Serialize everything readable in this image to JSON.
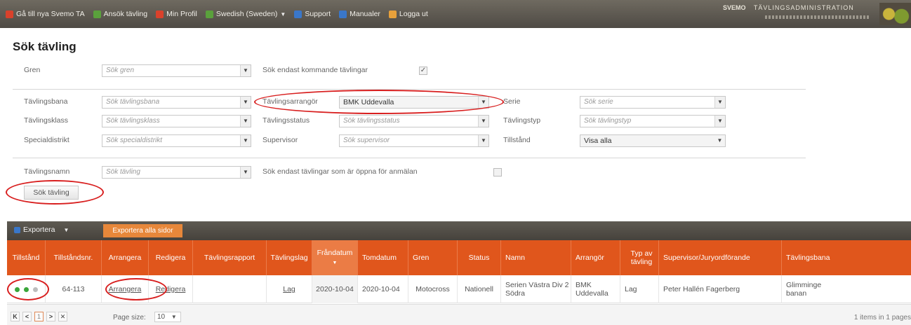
{
  "topnav": {
    "items": [
      {
        "label": "Gå till nya Svemo TA",
        "icon": "person-icon",
        "color": "#d9412b"
      },
      {
        "label": "Ansök tävling",
        "icon": "flag-icon",
        "color": "#5aa13c"
      },
      {
        "label": "Min Profil",
        "icon": "person-icon",
        "color": "#d9412b"
      },
      {
        "label": "Swedish (Sweden)",
        "icon": "arrow-left-icon",
        "color": "#5aa13c"
      },
      {
        "label": "Support",
        "icon": "info-icon",
        "color": "#3a77c9"
      },
      {
        "label": "Manualer",
        "icon": "book-icon",
        "color": "#3a77c9"
      },
      {
        "label": "Logga ut",
        "icon": "logout-icon",
        "color": "#e8a13b"
      }
    ],
    "brand_logo": "SVEMO",
    "brand_title": "TÄVLINGSADMINISTRATION"
  },
  "page_title": "Sök tävling",
  "filters": {
    "gren": {
      "label": "Gren",
      "placeholder": "Sök gren"
    },
    "upcoming_only": {
      "label": "Sök endast kommande tävlingar",
      "checked": true
    },
    "tavlingsbana": {
      "label": "Tävlingsbana",
      "placeholder": "Sök tävlingsbana"
    },
    "tavlingsarrangor": {
      "label": "Tävlingsarrangör",
      "value": "BMK Uddevalla"
    },
    "serie": {
      "label": "Serie",
      "placeholder": "Sök serie"
    },
    "tavlingsklass": {
      "label": "Tävlingsklass",
      "placeholder": "Sök tävlingsklass"
    },
    "tavlingsstatus": {
      "label": "Tävlingsstatus",
      "placeholder": "Sök tävlingsstatus"
    },
    "tavlingstyp": {
      "label": "Tävlingstyp",
      "placeholder": "Sök tävlingstyp"
    },
    "specialdistrikt": {
      "label": "Specialdistrikt",
      "placeholder": "Sök specialdistrikt"
    },
    "supervisor": {
      "label": "Supervisor",
      "placeholder": "Sök supervisor"
    },
    "tillstand": {
      "label": "Tillstånd",
      "value": "Visa alla"
    },
    "tavlingsnamn": {
      "label": "Tävlingsnamn",
      "placeholder": "Sök tävling"
    },
    "open_only": {
      "label": "Sök endast tävlingar som är öppna för anmälan",
      "checked": false
    },
    "search_button": "Sök tävling"
  },
  "grid_toolbar": {
    "export": "Exportera",
    "export_all": "Exportera alla sidor"
  },
  "table": {
    "columns": [
      "Tillstånd",
      "Tillståndsnr.",
      "Arrangera",
      "Redigera",
      "Tävlingsrapport",
      "Tävlingslag",
      "Fråndatum",
      "Tomdatum",
      "Gren",
      "Status",
      "Namn",
      "Arrangör",
      "Typ av tävling",
      "Supervisor/Juryordförande",
      "Tävlingsbana"
    ],
    "sorted_column": "Fråndatum",
    "rows": [
      {
        "tillstand_dots": [
          "#3aa63a",
          "#3aa63a",
          "#bdbdbd"
        ],
        "tillstandsnr": "64-113",
        "arrangera": "Arrangera",
        "redigera": "Redigera",
        "tavlingsrapport": "",
        "tavlingslag": "Lag",
        "frandatum": "2020-10-04",
        "tomdatum": "2020-10-04",
        "gren": "Motocross",
        "status": "Nationell",
        "namn": "Serien Västra Div 2 Södra",
        "arrangor": "BMK Uddevalla",
        "typ": "Lag",
        "supervisor": "Peter Hallén Fagerberg",
        "bana": "Glimminge banan"
      }
    ]
  },
  "pager": {
    "current_page": "1",
    "page_size_label": "Page size:",
    "page_size": "10",
    "info": "1 items in 1 pages"
  },
  "colors": {
    "header_orange": "#e0561c",
    "annotation_red": "#d81e1e"
  }
}
